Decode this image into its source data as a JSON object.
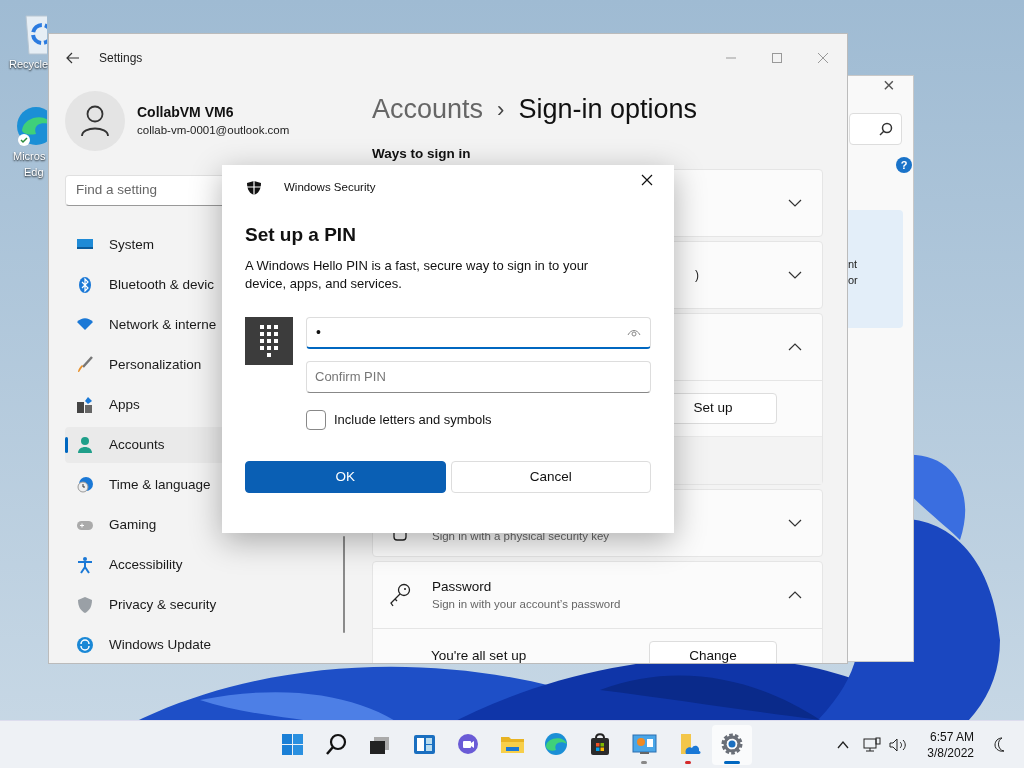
{
  "desktop_icons": [
    {
      "kind": "recycle-bin",
      "lines": [
        "Recycle"
      ]
    },
    {
      "kind": "edge",
      "lines": [
        "Micros",
        "Edg"
      ]
    }
  ],
  "back_window": {
    "close": "×",
    "help": "?",
    "panel_lines": [
      "nt",
      "or"
    ]
  },
  "settings": {
    "title": "Settings",
    "user": {
      "name": "CollabVM VM6",
      "email": "collab-vm-0001@outlook.com"
    },
    "search": {
      "placeholder": "Find a setting"
    },
    "nav": [
      {
        "label": "System",
        "selected": false
      },
      {
        "label": "Bluetooth & devic",
        "selected": false
      },
      {
        "label": "Network & interne",
        "selected": false
      },
      {
        "label": "Personalization",
        "selected": false
      },
      {
        "label": "Apps",
        "selected": false
      },
      {
        "label": "Accounts",
        "selected": true
      },
      {
        "label": "Time & language",
        "selected": false
      },
      {
        "label": "Gaming",
        "selected": false
      },
      {
        "label": "Accessibility",
        "selected": false
      },
      {
        "label": "Privacy & security",
        "selected": false
      },
      {
        "label": "Windows Update",
        "selected": false
      }
    ],
    "breadcrumb": {
      "parent": "Accounts",
      "separator": "›",
      "current": "Sign-in options"
    },
    "section": "Ways to sign in",
    "cards": [
      {
        "expanded": false
      },
      {
        "expanded": false,
        "fragment": ")"
      },
      {
        "expanded": true,
        "button": "Set up"
      },
      {
        "expanded": false,
        "subtitle": "Sign in with a physical security key"
      },
      {
        "expanded": true,
        "title": "Password",
        "subtitle": "Sign in with your account’s password",
        "row_text": "You're all set up",
        "button": "Change"
      }
    ]
  },
  "dialog": {
    "app": "Windows Security",
    "title": "Set up a PIN",
    "description": "A Windows Hello PIN is a fast, secure way to sign in to your device, apps, and services.",
    "pin": {
      "value": "•"
    },
    "confirm": {
      "placeholder": "Confirm PIN"
    },
    "checkbox": {
      "label": "Include letters and symbols",
      "checked": false
    },
    "buttons": [
      {
        "label": "OK",
        "primary": true
      },
      {
        "label": "Cancel",
        "primary": false
      }
    ]
  },
  "taskbar": {
    "apps": [
      {
        "kind": "start",
        "running": false,
        "attention": false,
        "active": false
      },
      {
        "kind": "search",
        "running": false,
        "attention": false,
        "active": false
      },
      {
        "kind": "task-view",
        "running": false,
        "attention": false,
        "active": false
      },
      {
        "kind": "widgets",
        "running": false,
        "attention": false,
        "active": false
      },
      {
        "kind": "chat",
        "running": false,
        "attention": false,
        "active": false
      },
      {
        "kind": "explorer",
        "running": false,
        "attention": false,
        "active": false
      },
      {
        "kind": "edge",
        "running": false,
        "attention": false,
        "active": false
      },
      {
        "kind": "store",
        "running": false,
        "attention": false,
        "active": false
      },
      {
        "kind": "control-panel",
        "running": true,
        "attention": false,
        "active": false
      },
      {
        "kind": "onedrive-folder",
        "running": true,
        "attention": true,
        "active": false
      },
      {
        "kind": "settings",
        "running": true,
        "attention": false,
        "active": true
      }
    ],
    "time": "6:57 AM",
    "date": "3/8/2022"
  }
}
